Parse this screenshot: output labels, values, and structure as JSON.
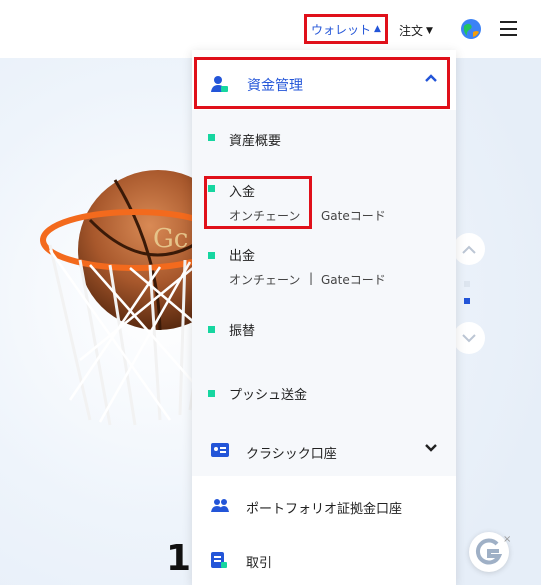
{
  "header": {
    "wallet_label": "ウォレット",
    "orders_label": "注文",
    "wallet_caret": "▲",
    "orders_caret": "▼"
  },
  "hero": {
    "big_number": "1,",
    "ball_text": "Gc"
  },
  "dropdown": {
    "section_title": "資金管理",
    "section_chevron": "^",
    "sub_items": [
      {
        "label": "資産概要"
      },
      {
        "label": "入金",
        "links": [
          "オンチェーン",
          "Gateコード"
        ]
      },
      {
        "label": "出金",
        "links": [
          "オンチェーン",
          "Gateコード"
        ],
        "separator": "|"
      },
      {
        "label": "振替"
      },
      {
        "label": "プッシュ送金"
      }
    ],
    "main_items": [
      {
        "label": "クラシック口座",
        "chevron": "v"
      },
      {
        "label": "ポートフォリオ証拠金口座"
      },
      {
        "label": "取引"
      }
    ]
  },
  "floater": {
    "close": "×"
  },
  "colors": {
    "accent": "#2355d8",
    "highlight": "#e0101a",
    "bullet": "#16d6a0"
  }
}
